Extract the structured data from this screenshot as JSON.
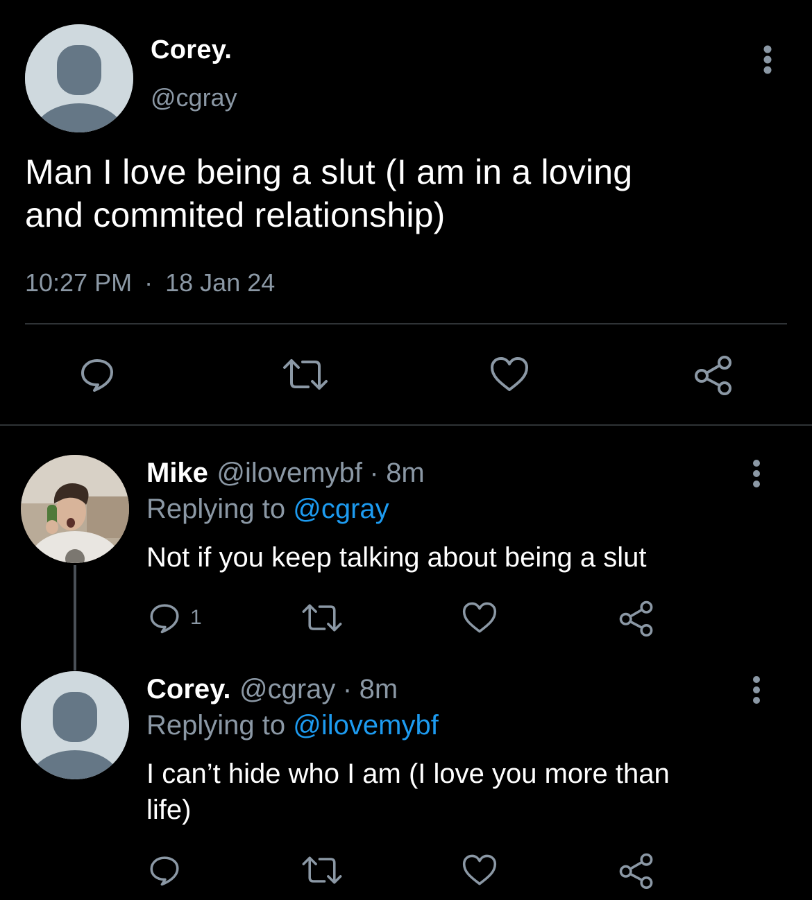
{
  "main_tweet": {
    "name": "Corey.",
    "handle": "@cgray",
    "text_line1": "Man I love being a slut (I am in a loving",
    "text_line2": "and commited relationship)",
    "time": "10:27 PM",
    "separator": "·",
    "date": "18 Jan 24",
    "avatar_icon": "default-avatar-icon",
    "actions": [
      "reply-icon",
      "retweet-icon",
      "like-icon",
      "share-icon"
    ]
  },
  "replies": [
    {
      "name": "Mike",
      "handle": "@ilovemybf",
      "separator": "·",
      "time": "8m",
      "replying_prefix": "Replying to",
      "replying_to": "@cgray",
      "text": "Not if you keep talking about being a slut",
      "reply_count": "1",
      "avatar_icon": "photo-avatar"
    },
    {
      "name": "Corey.",
      "handle": "@cgray",
      "separator": "·",
      "time": "8m",
      "replying_prefix": "Replying to",
      "replying_to": "@ilovemybf",
      "text_line1": "I can’t hide who I am (I love you more than",
      "text_line2": "life)",
      "avatar_icon": "default-avatar-icon"
    }
  ],
  "colors": {
    "background": "#000000",
    "text": "#ffffff",
    "secondary": "#8b98a5",
    "link": "#1d9bf0",
    "divider": "#2f3336"
  }
}
